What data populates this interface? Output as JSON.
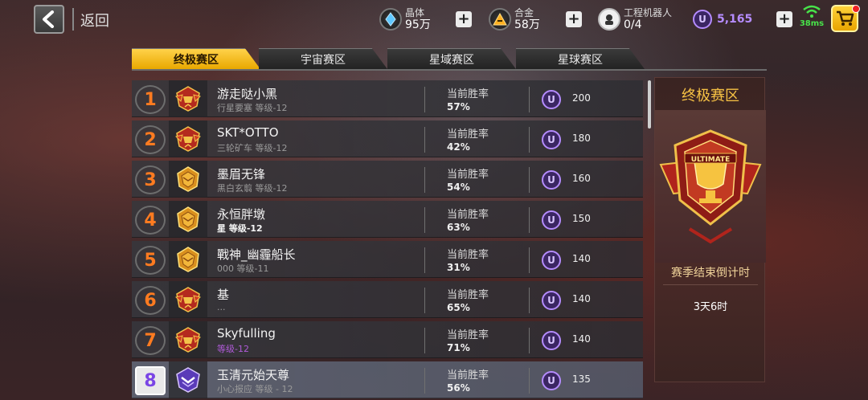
{
  "header": {
    "back_label": "返回",
    "resources": [
      {
        "name": "晶体",
        "value": "95万",
        "icon": "crystal-icon"
      },
      {
        "name": "合金",
        "value": "58万",
        "icon": "alloy-icon"
      },
      {
        "name": "工程机器人",
        "value": "0/4",
        "icon": "robot-icon"
      }
    ],
    "currency": {
      "symbol": "U",
      "value": "5,165"
    },
    "ping": "38ms"
  },
  "tabs": [
    {
      "label": "终极赛区",
      "active": true
    },
    {
      "label": "宇宙赛区",
      "active": false
    },
    {
      "label": "星域赛区",
      "active": false
    },
    {
      "label": "星球赛区",
      "active": false
    }
  ],
  "leaderboard": {
    "winrate_label": "当前胜率",
    "coin_symbol": "U",
    "rows": [
      {
        "rank": "1",
        "name": "游走哒小黑",
        "sub": "行星要塞 等级-12",
        "winrate": "57%",
        "reward": "200",
        "badge": "red"
      },
      {
        "rank": "2",
        "name": "SKT*OTTO",
        "sub": "三轮矿车 等级-12",
        "winrate": "42%",
        "reward": "180",
        "badge": "red"
      },
      {
        "rank": "3",
        "name": "墨眉无锋",
        "sub": "黑白玄翦 等级-12",
        "winrate": "54%",
        "reward": "160",
        "badge": "gold"
      },
      {
        "rank": "4",
        "name": "永恒胖墩",
        "sub": "星 等级-12",
        "winrate": "63%",
        "reward": "150",
        "badge": "gold"
      },
      {
        "rank": "5",
        "name": "戰神_幽霾船长",
        "sub": "000 等级-11",
        "winrate": "31%",
        "reward": "140",
        "badge": "gold"
      },
      {
        "rank": "6",
        "name": "基",
        "sub": "...",
        "winrate": "65%",
        "reward": "140",
        "badge": "red"
      },
      {
        "rank": "7",
        "name": "Skyfulling",
        "sub": "等级-12",
        "winrate": "71%",
        "reward": "140",
        "badge": "red"
      },
      {
        "rank": "8",
        "name": "玉清元始天尊",
        "sub": "小心报应 等级 - 12",
        "winrate": "56%",
        "reward": "135",
        "badge": "purple"
      }
    ]
  },
  "panel": {
    "title": "终极赛区",
    "emblem_text": "ULTIMATE",
    "countdown_label": "赛季结束倒计时",
    "countdown_value": "3天6时"
  },
  "colors": {
    "accent_gold": "#f7c244",
    "rank_orange": "#ff7b20",
    "currency_purple": "#b58cff",
    "ping_green": "#48e34a"
  }
}
